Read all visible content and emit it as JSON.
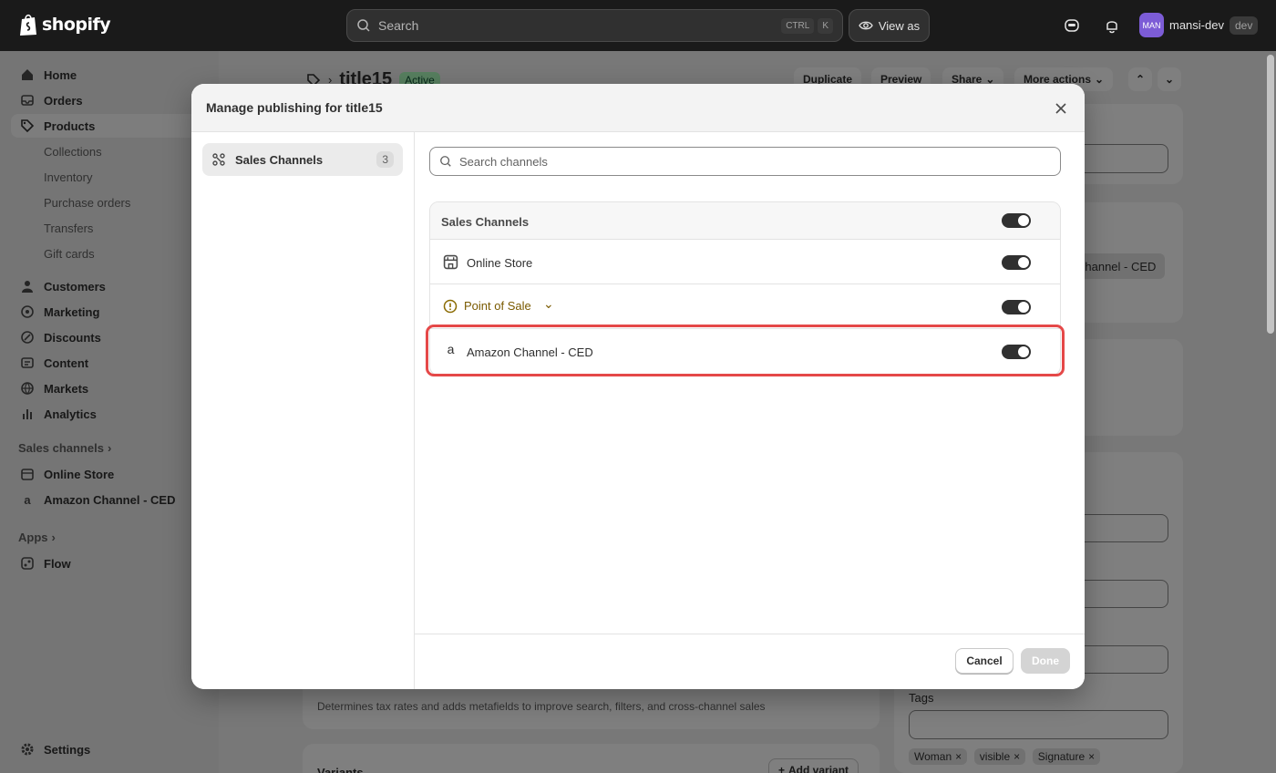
{
  "topbar": {
    "brand": "shopify",
    "search_placeholder": "Search",
    "kbd_ctrl": "CTRL",
    "kbd_k": "K",
    "view_as": "View as",
    "avatar_initials": "MAN",
    "user_name": "mansi-dev",
    "user_tag": "dev"
  },
  "sidebar": {
    "items": [
      {
        "label": "Home"
      },
      {
        "label": "Orders"
      },
      {
        "label": "Products"
      },
      {
        "label": "Customers"
      },
      {
        "label": "Marketing"
      },
      {
        "label": "Discounts"
      },
      {
        "label": "Content"
      },
      {
        "label": "Markets"
      },
      {
        "label": "Analytics"
      }
    ],
    "product_subitems": [
      "Collections",
      "Inventory",
      "Purchase orders",
      "Transfers",
      "Gift cards"
    ],
    "sales_channels_label": "Sales channels",
    "channels": [
      "Online Store",
      "Amazon Channel - CED"
    ],
    "apps_label": "Apps",
    "apps": [
      "Flow"
    ],
    "settings_label": "Settings"
  },
  "page": {
    "product_title": "title15",
    "status": "Active",
    "actions": [
      "Duplicate",
      "Preview",
      "Share",
      "More actions"
    ],
    "channel_chip": "Channel - CED",
    "category_help": "Determines tax rates and adds metafields to improve search, filters, and cross-channel sales",
    "tags_label": "Tags",
    "tags": [
      "Woman",
      "visible",
      "Signature"
    ],
    "variants_label": "Variants",
    "add_variant": "Add variant"
  },
  "modal": {
    "title": "Manage publishing for title15",
    "left_item_label": "Sales Channels",
    "left_item_count": "3",
    "search_placeholder": "Search channels",
    "section_label": "Sales Channels",
    "channels": [
      {
        "label": "Online Store",
        "enabled": true
      },
      {
        "label": "Point of Sale",
        "enabled": true
      },
      {
        "label": "Amazon Channel - CED",
        "enabled": true
      }
    ],
    "cancel_label": "Cancel",
    "done_label": "Done"
  }
}
